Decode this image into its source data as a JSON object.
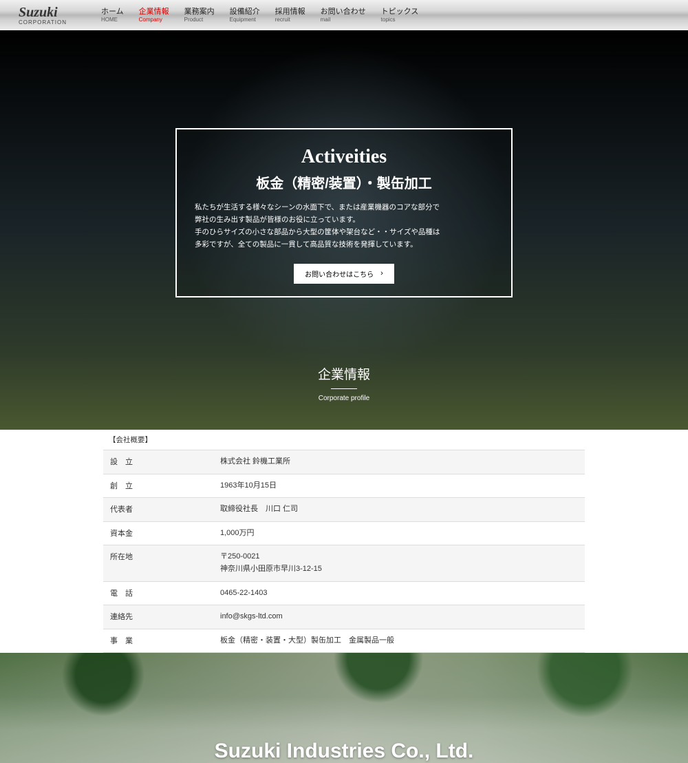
{
  "logo": {
    "main": "Suzuki",
    "sub": "CORPORATION"
  },
  "nav": [
    {
      "jp": "ホーム",
      "en": "HOME",
      "active": false
    },
    {
      "jp": "企業情報",
      "en": "Company",
      "active": true
    },
    {
      "jp": "業務案内",
      "en": "Product",
      "active": false
    },
    {
      "jp": "設備紹介",
      "en": "Equipment",
      "active": false
    },
    {
      "jp": "採用情報",
      "en": "recruit",
      "active": false
    },
    {
      "jp": "お問い合わせ",
      "en": "mail",
      "active": false
    },
    {
      "jp": "トピックス",
      "en": "topics",
      "active": false
    }
  ],
  "hero": {
    "title": "Activeities",
    "subtitle": "板金（精密/装置）・製缶加工",
    "desc": "私たちが生活する様々なシーンの水面下で、または産業機器のコアな部分で\n弊社の生み出す製品が皆様のお役に立っています。\n手のひらサイズの小さな部品から大型の筐体や架台など・・サイズや品種は\n多彩ですが、全ての製品に一貫して高品質な技術を発揮しています。",
    "button": "お問い合わせはこちら",
    "lower_jp": "企業情報",
    "lower_en": "Corporate profile"
  },
  "profile": {
    "heading": "【会社概要】",
    "rows": [
      {
        "label": "設　立",
        "value": "株式会社 鈴機工業所"
      },
      {
        "label": "創　立",
        "value": "1963年10月15日"
      },
      {
        "label": "代表者",
        "value": "取締役社長　川口 仁司"
      },
      {
        "label": "資本金",
        "value": "1,000万円"
      },
      {
        "label": "所在地",
        "value": "〒250-0021\n神奈川県小田原市早川3-12-15"
      },
      {
        "label": "電　話",
        "value": "0465-22-1403"
      },
      {
        "label": "連絡先",
        "value": "info@skgs-ltd.com"
      },
      {
        "label": "事　業",
        "value": "板金（精密・装置・大型）製缶加工　金属製品一般"
      }
    ]
  },
  "bottom": {
    "title": "Suzuki Industries Co., Ltd."
  }
}
